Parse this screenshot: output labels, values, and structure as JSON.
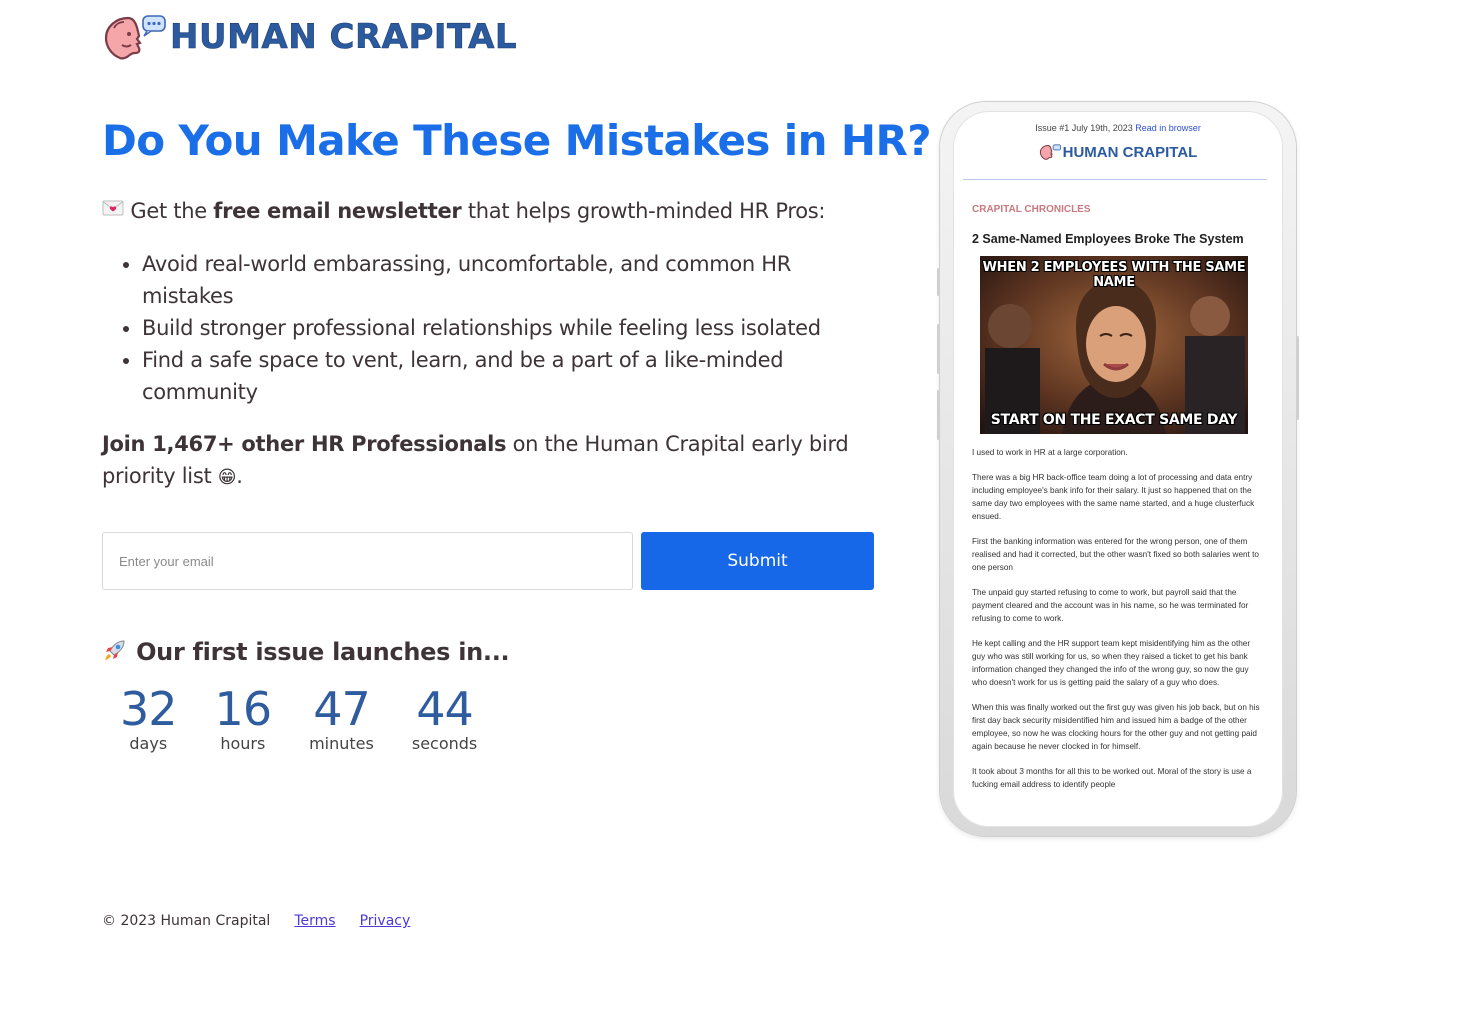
{
  "brand": {
    "name": "HUMAN CRAPITAL",
    "mascot_icon": "speaking-head-icon"
  },
  "hero": {
    "headline": "Do You Make These Mistakes in HR?",
    "intro_icon": "love-letter-icon",
    "intro_prefix": "Get the",
    "intro_bold": "free email newsletter",
    "intro_suffix": "that helps growth-minded HR Pros:",
    "bullets": [
      "Avoid real-world embarassing, uncomfortable, and common HR mistakes",
      "Build stronger professional relationships while feeling less isolated",
      "Find a safe space to vent, learn, and be a part of a like-minded community"
    ],
    "join_bold": "Join 1,467+ other HR Professionals",
    "join_rest": "on the Human Crapital early bird priority list",
    "join_emoji": "😁",
    "join_end": "."
  },
  "form": {
    "email_placeholder": "Enter your email",
    "submit_label": "Submit"
  },
  "launch": {
    "icon": "rocket-icon",
    "heading": "Our first issue launches in...",
    "countdown": [
      {
        "value": "32",
        "label": "days"
      },
      {
        "value": "16",
        "label": "hours"
      },
      {
        "value": "47",
        "label": "minutes"
      },
      {
        "value": "44",
        "label": "seconds"
      }
    ]
  },
  "footer": {
    "copyright": "© 2023 Human Crapital",
    "terms": "Terms",
    "privacy": "Privacy"
  },
  "preview": {
    "issue_line": "Issue #1 July 19th, 2023",
    "read_in_browser": "Read in browser",
    "logo_text": "HUMAN CRAPITAL",
    "kicker": "CRAPITAL CHRONICLES",
    "title": "2 Same-Named Employees Broke The System",
    "meme_top": "WHEN 2 EMPLOYEES WITH THE SAME NAME",
    "meme_bottom": "START ON THE EXACT SAME DAY",
    "paragraphs": [
      "I used to work in HR at a large corporation.",
      "There was a big HR back-office team doing a lot of processing and data entry including employee's bank info for their salary. It just so happened that on the same day two employees with the same name started, and a huge clusterfuck ensued.",
      "First the banking information was entered for the wrong person, one of them realised and had it corrected, but the other wasn't fixed so both salaries went to one person",
      "The unpaid guy started refusing to come to work, but payroll said that the payment cleared and the account was in his name, so he was terminated for refusing to come to work.",
      "He kept calling and the HR support team kept misidentifying him as the other guy who was still working for us, so when they raised a ticket to get his bank information changed they changed the info of the wrong guy, so now the guy who doesn't work for us is getting paid the salary of a guy who does.",
      "When this was finally worked out the first guy was given his job back, but on his first day back security misidentified him and issued him a badge of the other employee, so now he was clocking hours for the other guy and not getting paid again because he never clocked in for himself.",
      "It took about 3 months for all this to be worked out. Moral of the story is use a fucking email address to identify people"
    ]
  },
  "colors": {
    "accent": "#1a6fe8",
    "brand_blue": "#2b5a9e",
    "text": "#3e3438",
    "link": "#4b3ad8"
  }
}
